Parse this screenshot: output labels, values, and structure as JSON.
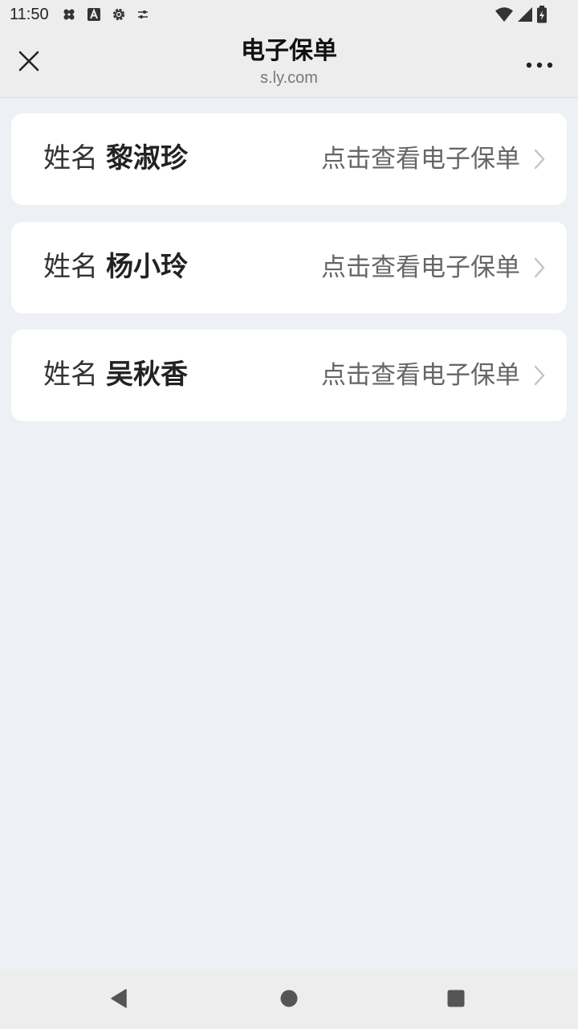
{
  "status_bar": {
    "time": "11:50",
    "left_icons": [
      "bandage-icon",
      "a-box-icon",
      "gear-icon",
      "sliders-icon"
    ],
    "right_icons": [
      "wifi-icon",
      "cell-signal-icon",
      "battery-charging-icon"
    ]
  },
  "header": {
    "title": "电子保单",
    "subtitle": "s.ly.com",
    "close_icon": "close-icon",
    "more_icon": "more-dots-icon"
  },
  "policies": [
    {
      "label": "姓名",
      "name": "黎淑珍",
      "action": "点击查看电子保单"
    },
    {
      "label": "姓名",
      "name": "杨小玲",
      "action": "点击查看电子保单"
    },
    {
      "label": "姓名",
      "name": "吴秋香",
      "action": "点击查看电子保单"
    }
  ],
  "nav_bar": {
    "back_icon": "back-triangle-icon",
    "home_icon": "home-circle-icon",
    "recents_icon": "recents-square-icon"
  },
  "colors": {
    "page_background": "#edf0f4",
    "bar_background": "#ededed",
    "card_background": "#ffffff",
    "name_text": "#222222",
    "action_text": "#666666"
  }
}
